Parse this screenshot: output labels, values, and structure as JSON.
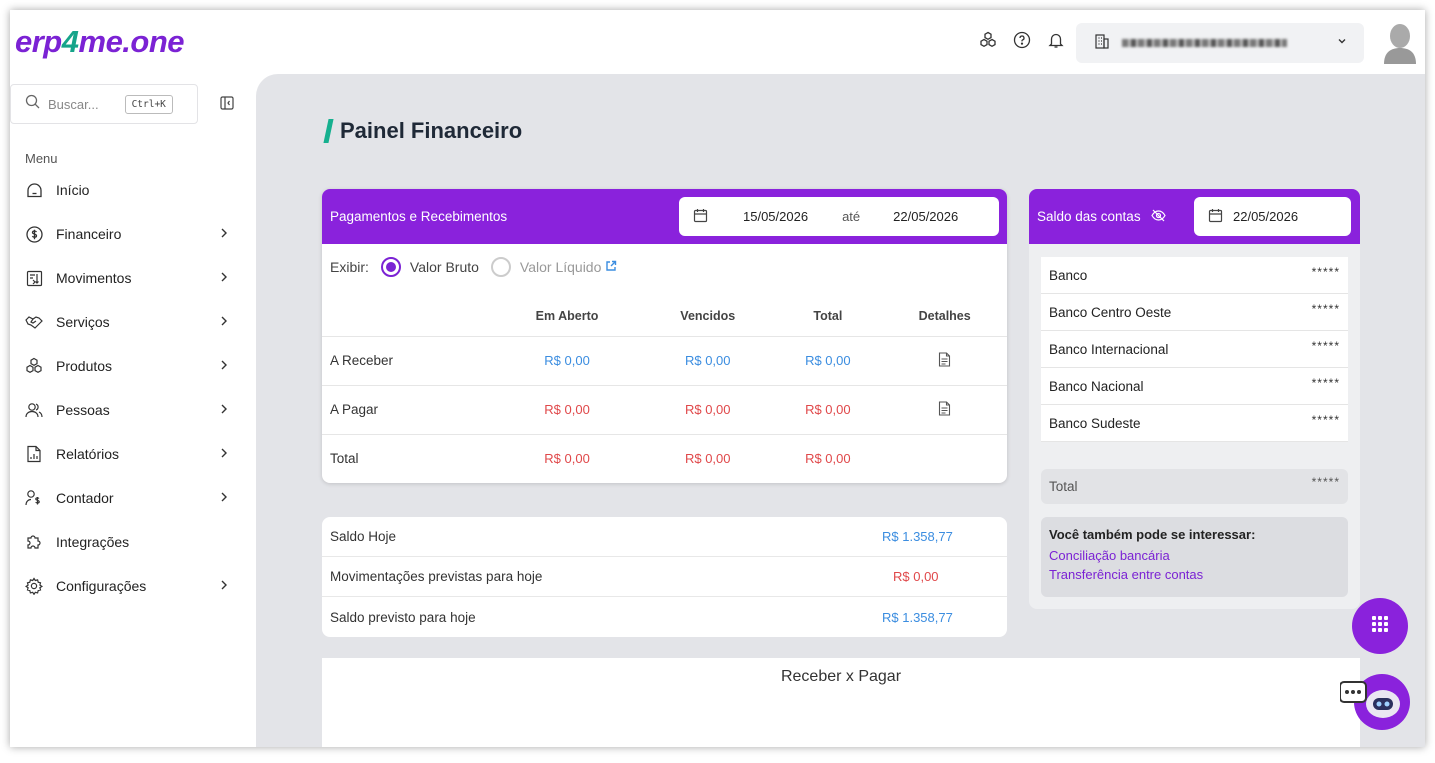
{
  "brand": {
    "logo_a": "erp",
    "logo_b": "4",
    "logo_c": "me.one"
  },
  "search": {
    "placeholder": "Buscar...",
    "shortcut": "Ctrl+K"
  },
  "menu": {
    "label": "Menu",
    "items": [
      {
        "label": "Início",
        "icon": "home-icon",
        "arrow": false
      },
      {
        "label": "Financeiro",
        "icon": "dollar-circle-icon",
        "arrow": true
      },
      {
        "label": "Movimentos",
        "icon": "money-transfer-icon",
        "arrow": true
      },
      {
        "label": "Serviços",
        "icon": "handshake-icon",
        "arrow": true
      },
      {
        "label": "Produtos",
        "icon": "boxes-icon",
        "arrow": true
      },
      {
        "label": "Pessoas",
        "icon": "people-icon",
        "arrow": true
      },
      {
        "label": "Relatórios",
        "icon": "report-icon",
        "arrow": true
      },
      {
        "label": "Contador",
        "icon": "accountant-icon",
        "arrow": true
      },
      {
        "label": "Integrações",
        "icon": "puzzle-icon",
        "arrow": false
      },
      {
        "label": "Configurações",
        "icon": "gear-icon",
        "arrow": true
      }
    ]
  },
  "page": {
    "title": "Painel Financeiro"
  },
  "pagamentos": {
    "header": "Pagamentos e Recebimentos",
    "date_from": "15/05/2026",
    "date_sep": "até",
    "date_to": "22/05/2026",
    "exibir_label": "Exibir:",
    "option_bruto": "Valor Bruto",
    "option_liquido": "Valor Líquido",
    "columns": [
      "Em Aberto",
      "Vencidos",
      "Total",
      "Detalhes"
    ],
    "rows": [
      {
        "label": "A Receber",
        "em_aberto": "R$ 0,00",
        "vencidos": "R$ 0,00",
        "total": "R$ 0,00"
      },
      {
        "label": "A Pagar",
        "em_aberto": "R$ 0,00",
        "vencidos": "R$ 0,00",
        "total": "R$ 0,00"
      },
      {
        "label": "Total",
        "em_aberto": "R$ 0,00",
        "vencidos": "R$ 0,00",
        "total": "R$ 0,00"
      }
    ]
  },
  "saldo": [
    {
      "label": "Saldo Hoje",
      "value": "R$ 1.358,77"
    },
    {
      "label": "Movimentações previstas para hoje",
      "value": "R$ 0,00"
    },
    {
      "label": "Saldo previsto para hoje",
      "value": "R$ 1.358,77"
    }
  ],
  "contas": {
    "header": "Saldo das contas",
    "date": "22/05/2026",
    "banks": [
      {
        "name": "Banco",
        "value": "*****"
      },
      {
        "name": "Banco Centro Oeste",
        "value": "*****"
      },
      {
        "name": "Banco Internacional",
        "value": "*****"
      },
      {
        "name": "Banco Nacional",
        "value": "*****"
      },
      {
        "name": "Banco Sudeste",
        "value": "*****"
      }
    ],
    "total_label": "Total",
    "total_value": "*****",
    "interest_title": "Você também pode se interessar:",
    "links": [
      "Conciliação bancária",
      "Transferência entre contas"
    ]
  },
  "chart": {
    "title": "Receber x Pagar"
  },
  "colors": {
    "brand_purple": "#8a22dc",
    "brand_green": "#16a48a",
    "positive": "#3b8de0",
    "negative": "#e0484a"
  }
}
